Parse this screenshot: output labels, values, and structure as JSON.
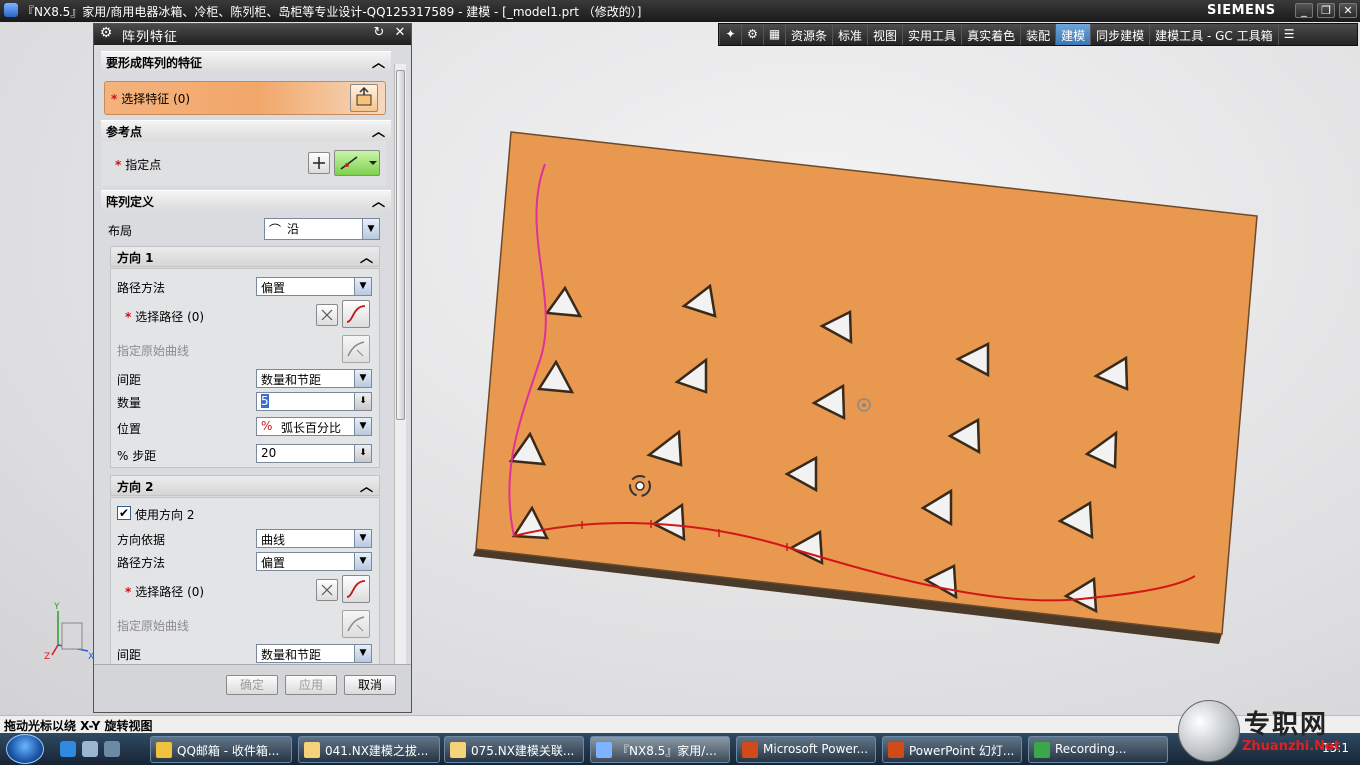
{
  "window": {
    "title": "『NX8.5』家用/商用电器冰箱、冷柜、陈列柜、岛柜等专业设计-QQ125317589 - 建模 - [_model1.prt （修改的）]",
    "brand": "SIEMENS",
    "controls": [
      "_",
      "❐",
      "✕"
    ]
  },
  "ribbon": {
    "tabs": [
      "资源条",
      "标准",
      "视图",
      "实用工具",
      "真实着色",
      "装配",
      "建模",
      "同步建模",
      "建模工具 - GC 工具箱"
    ],
    "active_tab": "建模"
  },
  "dialog": {
    "title": "阵列特征",
    "sections": {
      "features": {
        "title": "要形成阵列的特征",
        "select_label": "选择特征 (0)"
      },
      "reference": {
        "title": "参考点",
        "point_label": "指定点"
      },
      "definition": {
        "title": "阵列定义",
        "layout_label": "布局",
        "layout_value": "沿",
        "dir1": {
          "title": "方向 1",
          "path_method_label": "路径方法",
          "path_method_value": "偏置",
          "select_path_label": "选择路径 (0)",
          "orig_curve_label": "指定原始曲线",
          "spacing_label": "间距",
          "spacing_value": "数量和节距",
          "count_label": "数量",
          "count_value": "5",
          "position_label": "位置",
          "position_value": "弧长百分比",
          "pitch_label": "% 步距",
          "pitch_value": "20"
        },
        "dir2": {
          "title": "方向 2",
          "use_label": "使用方向 2",
          "use_checked": true,
          "basis_label": "方向依据",
          "basis_value": "曲线",
          "path_method_label": "路径方法",
          "path_method_value": "偏置",
          "select_path_label": "选择路径 (0)",
          "orig_curve_label": "指定原始曲线",
          "spacing_label": "间距",
          "spacing_value": "数量和节距"
        }
      }
    },
    "buttons": {
      "ok": "确定",
      "apply": "应用",
      "cancel": "取消"
    }
  },
  "statusbar": {
    "text": "拖动光标以绕 X-Y 旋转视图"
  },
  "taskbar": {
    "items": [
      "QQ邮箱 - 收件箱...",
      "041.NX建模之拔...",
      "075.NX建模关联...",
      "『NX8.5』家用/...",
      "Microsoft Power...",
      "PowerPoint 幻灯...",
      "Recording..."
    ],
    "clock": "15:1"
  },
  "watermark": {
    "zh": "专职网",
    "en": "Zhuanzhi.Net"
  },
  "colors": {
    "plate": "#e8984f",
    "curve_magenta": "#e0309a",
    "curve_red": "#d01818",
    "accent_select": "#f2a76a"
  }
}
